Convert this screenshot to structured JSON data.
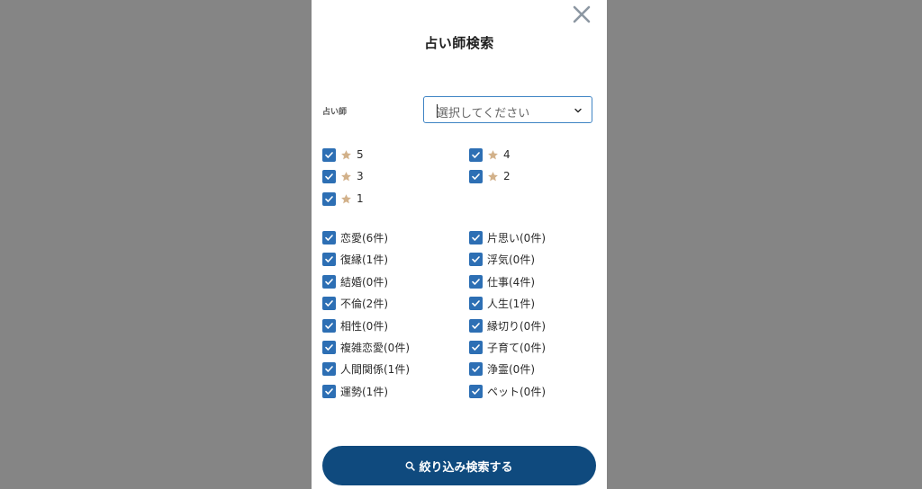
{
  "modal": {
    "title": "占い師検索",
    "close_icon": "close-icon"
  },
  "fortune_teller_field": {
    "label": "占い師",
    "placeholder": "選択してください"
  },
  "ratings": [
    {
      "value": "5",
      "checked": true
    },
    {
      "value": "4",
      "checked": true
    },
    {
      "value": "3",
      "checked": true
    },
    {
      "value": "2",
      "checked": true
    },
    {
      "value": "1",
      "checked": true
    }
  ],
  "categories": [
    {
      "label": "恋愛(6件)",
      "checked": true
    },
    {
      "label": "片思い(0件)",
      "checked": true
    },
    {
      "label": "復縁(1件)",
      "checked": true
    },
    {
      "label": "浮気(0件)",
      "checked": true
    },
    {
      "label": "結婚(0件)",
      "checked": true
    },
    {
      "label": "仕事(4件)",
      "checked": true
    },
    {
      "label": "不倫(2件)",
      "checked": true
    },
    {
      "label": "人生(1件)",
      "checked": true
    },
    {
      "label": "相性(0件)",
      "checked": true
    },
    {
      "label": "縁切り(0件)",
      "checked": true
    },
    {
      "label": "複雑恋愛(0件)",
      "checked": true
    },
    {
      "label": "子育て(0件)",
      "checked": true
    },
    {
      "label": "人間関係(1件)",
      "checked": true
    },
    {
      "label": "浄霊(0件)",
      "checked": true
    },
    {
      "label": "運勢(1件)",
      "checked": true
    },
    {
      "label": "ペット(0件)",
      "checked": true
    }
  ],
  "search_button": {
    "label": "絞り込み検索する"
  },
  "colors": {
    "checkbox": "#2d6fb4",
    "star": "#d2b18a",
    "button": "#0f4a7e",
    "backdrop": "#858585"
  }
}
